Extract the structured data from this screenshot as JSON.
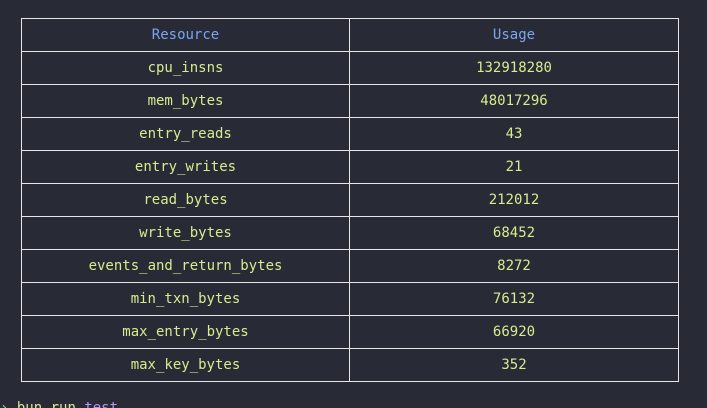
{
  "table": {
    "headers": [
      "Resource",
      "Usage"
    ],
    "rows": [
      {
        "resource": "cpu_insns",
        "usage": "132918280"
      },
      {
        "resource": "mem_bytes",
        "usage": "48017296"
      },
      {
        "resource": "entry_reads",
        "usage": "43"
      },
      {
        "resource": "entry_writes",
        "usage": "21"
      },
      {
        "resource": "read_bytes",
        "usage": "212012"
      },
      {
        "resource": "write_bytes",
        "usage": "68452"
      },
      {
        "resource": "events_and_return_bytes",
        "usage": "8272"
      },
      {
        "resource": "min_txn_bytes",
        "usage": "76132"
      },
      {
        "resource": "max_entry_bytes",
        "usage": "66920"
      },
      {
        "resource": "max_key_bytes",
        "usage": "352"
      }
    ]
  },
  "prompt": {
    "arrow": "›",
    "command": "bun run",
    "argument": "test"
  },
  "colors": {
    "background": "#282a36",
    "header_text": "#7aa6f0",
    "cell_text": "#d7ec8f",
    "border": "#e6e6e6"
  }
}
